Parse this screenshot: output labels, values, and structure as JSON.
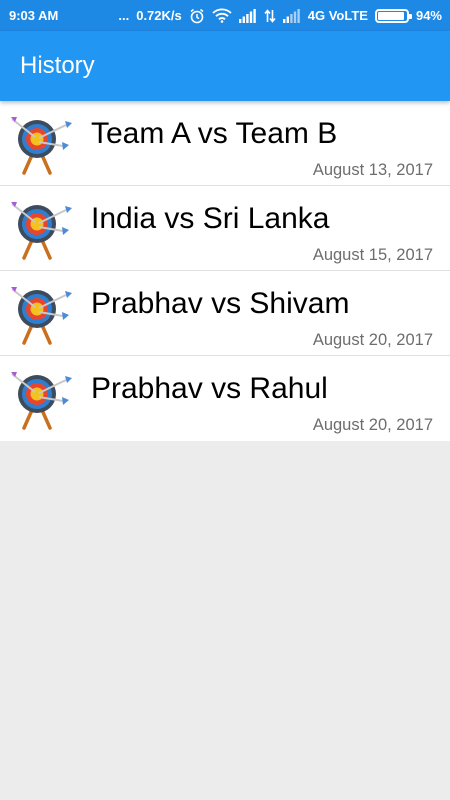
{
  "status_bar": {
    "time": "9:03 AM",
    "dots": "...",
    "speed": "0.72K/s",
    "network": "4G VoLTE",
    "battery_percent": "94%",
    "battery_level": 0.94,
    "icons": [
      "alarm-icon",
      "wifi-icon",
      "signal-icon",
      "data-transfer-icon",
      "signal-icon",
      "battery-icon"
    ]
  },
  "app_bar": {
    "title": "History",
    "color": "#2196f3"
  },
  "history": {
    "items": [
      {
        "title": "Team A vs Team B",
        "date": "August 13, 2017",
        "icon": "archery-target-icon"
      },
      {
        "title": "India vs Sri Lanka",
        "date": "August 15, 2017",
        "icon": "archery-target-icon"
      },
      {
        "title": "Prabhav vs Shivam",
        "date": "August 20, 2017",
        "icon": "archery-target-icon"
      },
      {
        "title": "Prabhav vs Rahul",
        "date": "August 20, 2017",
        "icon": "archery-target-icon"
      }
    ]
  }
}
